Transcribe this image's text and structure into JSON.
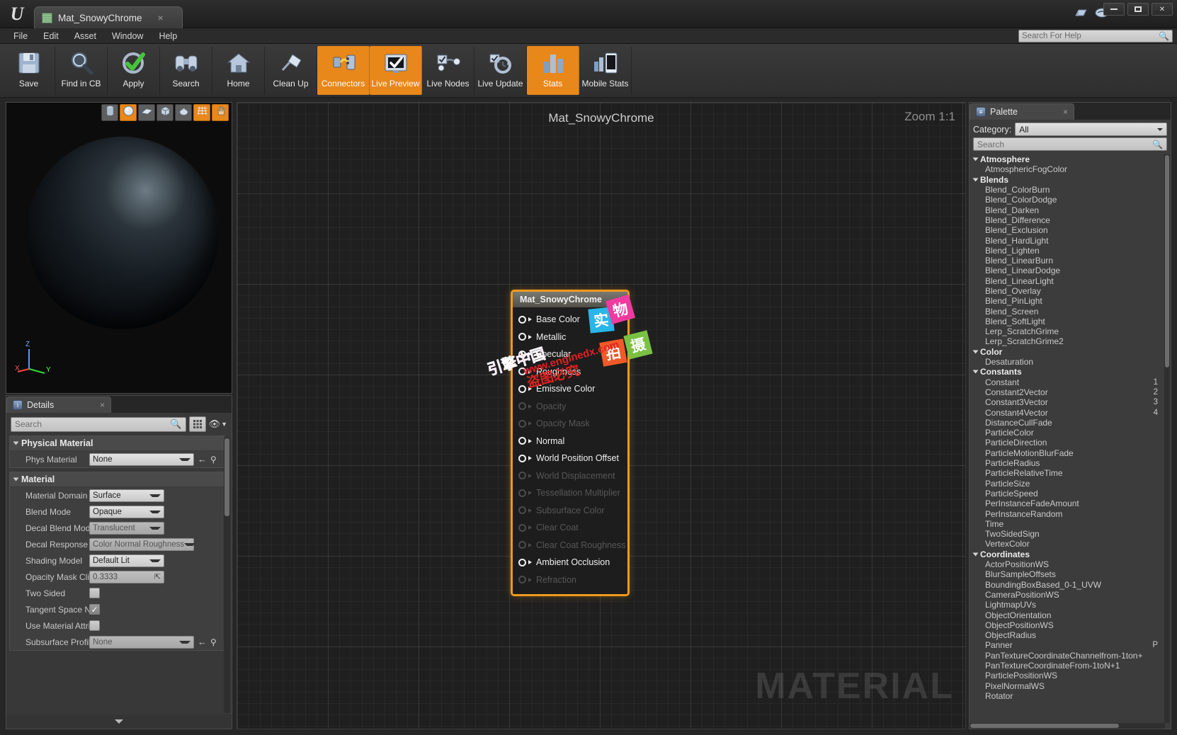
{
  "window": {
    "tab_title": "Mat_SnowyChrome",
    "tab_icon": "material-asset-icon",
    "tab_close": "×",
    "minimize": "minimize-icon",
    "maximize": "maximize-icon",
    "close": "✕"
  },
  "menubar": {
    "items": [
      "File",
      "Edit",
      "Asset",
      "Window",
      "Help"
    ],
    "help_search_placeholder": "Search For Help"
  },
  "toolbar": {
    "buttons": [
      {
        "label": "Save",
        "icon": "floppy-disk-icon",
        "active": false
      },
      {
        "label": "Find in CB",
        "icon": "magnifier-icon",
        "active": false
      },
      {
        "label": "Apply",
        "icon": "green-check-icon",
        "active": false
      },
      {
        "label": "Search",
        "icon": "binoculars-icon",
        "active": false
      },
      {
        "label": "Home",
        "icon": "house-icon",
        "active": false
      },
      {
        "label": "Clean Up",
        "icon": "broom-icon",
        "active": false
      },
      {
        "label": "Connectors",
        "icon": "connectors-icon",
        "active": true
      },
      {
        "label": "Live Preview",
        "icon": "monitor-check-icon",
        "active": true
      },
      {
        "label": "Live Nodes",
        "icon": "live-nodes-icon",
        "active": false
      },
      {
        "label": "Live Update",
        "icon": "live-update-icon",
        "active": false
      },
      {
        "label": "Stats",
        "icon": "bar-chart-icon",
        "active": true
      },
      {
        "label": "Mobile Stats",
        "icon": "mobile-stats-icon",
        "active": false
      }
    ]
  },
  "viewport": {
    "shapes": [
      {
        "name": "cylinder",
        "active": false
      },
      {
        "name": "sphere",
        "active": true
      },
      {
        "name": "plane",
        "active": false
      },
      {
        "name": "cube",
        "active": false
      },
      {
        "name": "teapot",
        "active": false
      },
      {
        "name": "grid",
        "active": true
      },
      {
        "name": "hand",
        "active": true
      }
    ],
    "axis": {
      "x": "X",
      "y": "Y",
      "z": "Z"
    }
  },
  "details": {
    "tab_label": "Details",
    "tab_icon": "details-info-icon",
    "tab_close": "×",
    "search_placeholder": "Search",
    "grid_button": "grid-view-icon",
    "eye_button": "visibility-icon",
    "groups": [
      {
        "name": "Physical Material",
        "rows": [
          {
            "label": "Phys Material",
            "type": "combo-xwide",
            "value": "None",
            "dim": false,
            "extras": [
              "arrow-back-icon",
              "browse-icon"
            ]
          }
        ]
      },
      {
        "name": "Material",
        "rows": [
          {
            "label": "Material Domain",
            "type": "combo",
            "value": "Surface",
            "dim": false
          },
          {
            "label": "Blend Mode",
            "type": "combo",
            "value": "Opaque",
            "dim": false
          },
          {
            "label": "Decal Blend Mode",
            "type": "combo",
            "value": "Translucent",
            "dim": true
          },
          {
            "label": "Decal Response",
            "type": "combo-xwide",
            "value": "Color Normal Roughness",
            "dim": true
          },
          {
            "label": "Shading Model",
            "type": "combo",
            "value": "Default Lit",
            "dim": false
          },
          {
            "label": "Opacity Mask Clip Value",
            "type": "num",
            "value": "0.3333",
            "dim": true
          },
          {
            "label": "Two Sided",
            "type": "check",
            "checked": false
          },
          {
            "label": "Tangent Space Normal",
            "type": "check",
            "checked": true
          },
          {
            "label": "Use Material Attributes",
            "type": "check",
            "checked": false
          },
          {
            "label": "Subsurface Profile",
            "type": "combo-xwide",
            "value": "None",
            "dim": true,
            "extras": [
              "arrow-back-icon",
              "browse-icon"
            ]
          }
        ]
      }
    ]
  },
  "graph": {
    "title": "Mat_SnowyChrome",
    "zoom": "Zoom 1:1",
    "watermark": "MATERIAL",
    "node": {
      "title": "Mat_SnowyChrome",
      "pins": [
        {
          "label": "Base Color",
          "enabled": true
        },
        {
          "label": "Metallic",
          "enabled": true
        },
        {
          "label": "Specular",
          "enabled": true
        },
        {
          "label": "Roughness",
          "enabled": true
        },
        {
          "label": "Emissive Color",
          "enabled": true
        },
        {
          "label": "Opacity",
          "enabled": false
        },
        {
          "label": "Opacity Mask",
          "enabled": false
        },
        {
          "label": "Normal",
          "enabled": true
        },
        {
          "label": "World Position Offset",
          "enabled": true
        },
        {
          "label": "World Displacement",
          "enabled": false
        },
        {
          "label": "Tessellation Multiplier",
          "enabled": false
        },
        {
          "label": "Subsurface Color",
          "enabled": false
        },
        {
          "label": "Clear Coat",
          "enabled": false
        },
        {
          "label": "Clear Coat Roughness",
          "enabled": false
        },
        {
          "label": "Ambient Occlusion",
          "enabled": true
        },
        {
          "label": "Refraction",
          "enabled": false
        }
      ]
    },
    "stickers": [
      {
        "text": "引擎中国",
        "kind": "text-pink"
      },
      {
        "text": "www.enginedx.com",
        "kind": "text-red"
      },
      {
        "text": "盗图必究",
        "kind": "text-red"
      },
      {
        "text": "实",
        "kind": "square-cyan",
        "color": "#29b6e8"
      },
      {
        "text": "物",
        "kind": "square-magenta",
        "color": "#ef3ba0"
      },
      {
        "text": "拍",
        "kind": "square-orange",
        "color": "#f05a28"
      },
      {
        "text": "摄",
        "kind": "square-green",
        "color": "#7ac143"
      }
    ]
  },
  "palette": {
    "tab_label": "Palette",
    "tab_icon": "palette-list-icon",
    "tab_close": "×",
    "category_label": "Category:",
    "category_value": "All",
    "search_placeholder": "Search",
    "groups": [
      {
        "name": "Atmosphere",
        "items": [
          {
            "label": "AtmosphericFogColor",
            "shortcut": ""
          }
        ]
      },
      {
        "name": "Blends",
        "items": [
          {
            "label": "Blend_ColorBurn",
            "shortcut": ""
          },
          {
            "label": "Blend_ColorDodge",
            "shortcut": ""
          },
          {
            "label": "Blend_Darken",
            "shortcut": ""
          },
          {
            "label": "Blend_Difference",
            "shortcut": ""
          },
          {
            "label": "Blend_Exclusion",
            "shortcut": ""
          },
          {
            "label": "Blend_HardLight",
            "shortcut": ""
          },
          {
            "label": "Blend_Lighten",
            "shortcut": ""
          },
          {
            "label": "Blend_LinearBurn",
            "shortcut": ""
          },
          {
            "label": "Blend_LinearDodge",
            "shortcut": ""
          },
          {
            "label": "Blend_LinearLight",
            "shortcut": ""
          },
          {
            "label": "Blend_Overlay",
            "shortcut": ""
          },
          {
            "label": "Blend_PinLight",
            "shortcut": ""
          },
          {
            "label": "Blend_Screen",
            "shortcut": ""
          },
          {
            "label": "Blend_SoftLight",
            "shortcut": ""
          },
          {
            "label": "Lerp_ScratchGrime",
            "shortcut": ""
          },
          {
            "label": "Lerp_ScratchGrime2",
            "shortcut": ""
          }
        ]
      },
      {
        "name": "Color",
        "items": [
          {
            "label": "Desaturation",
            "shortcut": ""
          }
        ]
      },
      {
        "name": "Constants",
        "items": [
          {
            "label": "Constant",
            "shortcut": "1"
          },
          {
            "label": "Constant2Vector",
            "shortcut": "2"
          },
          {
            "label": "Constant3Vector",
            "shortcut": "3"
          },
          {
            "label": "Constant4Vector",
            "shortcut": "4"
          },
          {
            "label": "DistanceCullFade",
            "shortcut": ""
          },
          {
            "label": "ParticleColor",
            "shortcut": ""
          },
          {
            "label": "ParticleDirection",
            "shortcut": ""
          },
          {
            "label": "ParticleMotionBlurFade",
            "shortcut": ""
          },
          {
            "label": "ParticleRadius",
            "shortcut": ""
          },
          {
            "label": "ParticleRelativeTime",
            "shortcut": ""
          },
          {
            "label": "ParticleSize",
            "shortcut": ""
          },
          {
            "label": "ParticleSpeed",
            "shortcut": ""
          },
          {
            "label": "PerInstanceFadeAmount",
            "shortcut": ""
          },
          {
            "label": "PerInstanceRandom",
            "shortcut": ""
          },
          {
            "label": "Time",
            "shortcut": ""
          },
          {
            "label": "TwoSidedSign",
            "shortcut": ""
          },
          {
            "label": "VertexColor",
            "shortcut": ""
          }
        ]
      },
      {
        "name": "Coordinates",
        "items": [
          {
            "label": "ActorPositionWS",
            "shortcut": ""
          },
          {
            "label": "BlurSampleOffsets",
            "shortcut": ""
          },
          {
            "label": "BoundingBoxBased_0-1_UVW",
            "shortcut": ""
          },
          {
            "label": "CameraPositionWS",
            "shortcut": ""
          },
          {
            "label": "LightmapUVs",
            "shortcut": ""
          },
          {
            "label": "ObjectOrientation",
            "shortcut": ""
          },
          {
            "label": "ObjectPositionWS",
            "shortcut": ""
          },
          {
            "label": "ObjectRadius",
            "shortcut": ""
          },
          {
            "label": "Panner",
            "shortcut": "P"
          },
          {
            "label": "PanTextureCoordinateChannelfrom-1ton+",
            "shortcut": ""
          },
          {
            "label": "PanTextureCoordinateFrom-1toN+1",
            "shortcut": ""
          },
          {
            "label": "ParticlePositionWS",
            "shortcut": ""
          },
          {
            "label": "PixelNormalWS",
            "shortcut": ""
          },
          {
            "label": "Rotator",
            "shortcut": ""
          }
        ]
      }
    ]
  }
}
